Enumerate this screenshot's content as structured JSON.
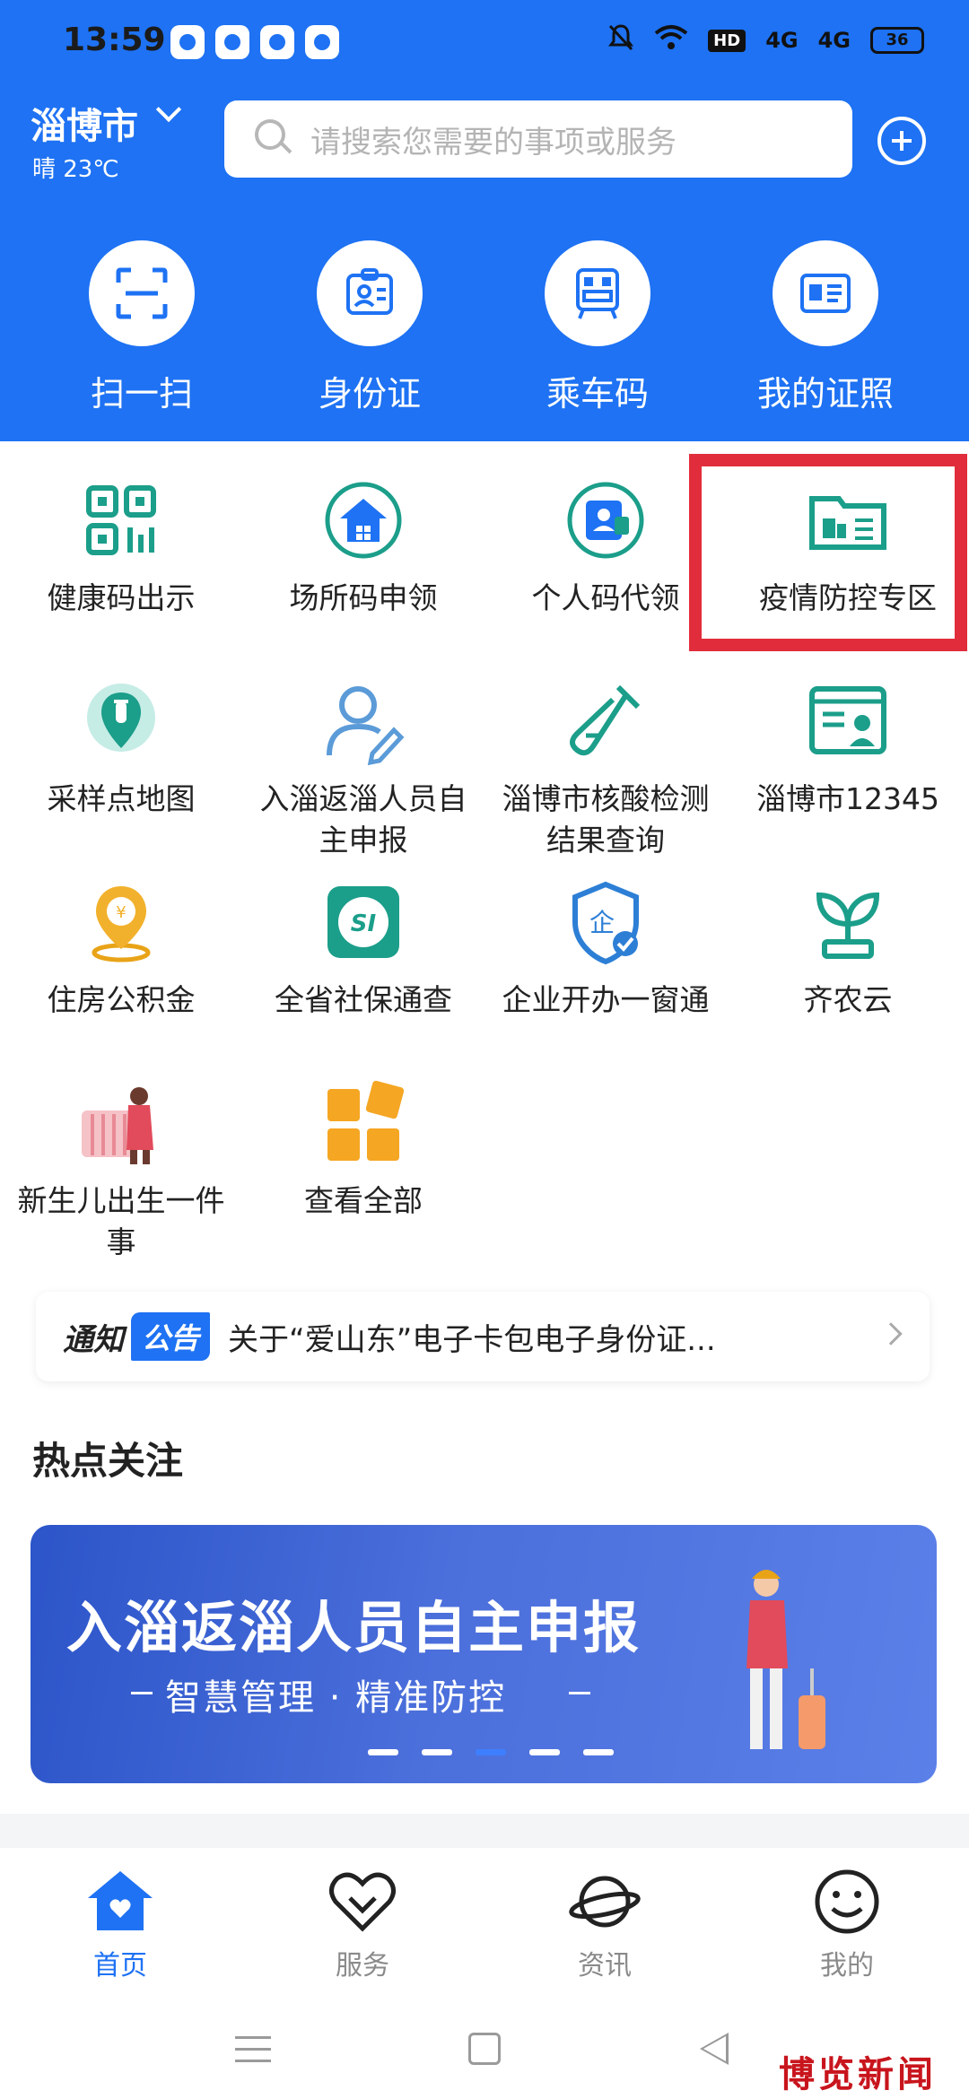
{
  "status_bar": {
    "time": "13:59",
    "network_badge": "HD",
    "signal_1": "4G",
    "signal_2": "4G",
    "battery": "36"
  },
  "header": {
    "city": "淄博市",
    "weather": "晴 23℃",
    "search_placeholder": "请搜索您需要的事项或服务"
  },
  "quick_actions": [
    {
      "label": "扫一扫",
      "icon": "scan-icon"
    },
    {
      "label": "身份证",
      "icon": "id-card-icon"
    },
    {
      "label": "乘车码",
      "icon": "bus-code-icon"
    },
    {
      "label": "我的证照",
      "icon": "license-icon"
    }
  ],
  "services": [
    {
      "label": "健康码出示",
      "icon": "qr-code-icon"
    },
    {
      "label": "场所码申领",
      "icon": "venue-code-icon"
    },
    {
      "label": "个人码代领",
      "icon": "personal-code-icon"
    },
    {
      "label": "疫情防控专区",
      "icon": "epidemic-zone-icon"
    },
    {
      "label": "采样点地图",
      "icon": "sampling-map-icon"
    },
    {
      "label": "入淄返淄人员自主申报",
      "icon": "person-edit-icon"
    },
    {
      "label": "淄博市核酸检测结果查询",
      "icon": "test-tube-icon"
    },
    {
      "label": "淄博市12345",
      "icon": "hotline-icon"
    },
    {
      "label": "住房公积金",
      "icon": "housing-fund-icon"
    },
    {
      "label": "全省社保通查",
      "icon": "social-security-icon"
    },
    {
      "label": "企业开办一窗通",
      "icon": "enterprise-shield-icon"
    },
    {
      "label": "齐农云",
      "icon": "sprout-icon"
    },
    {
      "label": "新生儿出生一件事",
      "icon": "newborn-icon"
    },
    {
      "label": "查看全部",
      "icon": "all-grid-icon"
    }
  ],
  "notice": {
    "tag_1": "通知",
    "tag_2": "公告",
    "text": "关于“爱山东”电子卡包电子身份证..."
  },
  "hot_section": {
    "title": "热点关注"
  },
  "banner": {
    "title": "入淄返淄人员自主申报",
    "subtitle": "智慧管理 · 精准防控"
  },
  "tabs": [
    {
      "label": "首页",
      "icon": "home-icon",
      "active": true
    },
    {
      "label": "服务",
      "icon": "heart-icon",
      "active": false
    },
    {
      "label": "资讯",
      "icon": "planet-icon",
      "active": false
    },
    {
      "label": "我的",
      "icon": "smile-icon",
      "active": false
    }
  ],
  "watermark": "博览新闻",
  "colors": {
    "brand_blue": "#1e72f3",
    "icon_teal": "#1b9e8a",
    "highlight_red": "#e12d3b"
  }
}
